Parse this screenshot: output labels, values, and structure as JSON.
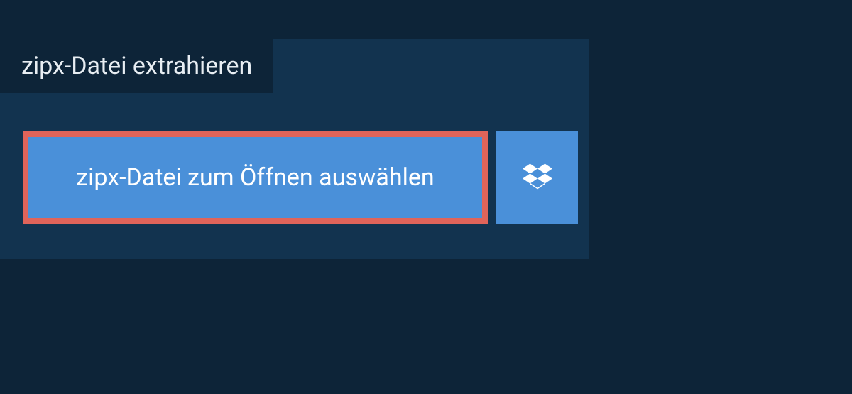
{
  "tab": {
    "label": "zipx-Datei extrahieren"
  },
  "actions": {
    "select_file_label": "zipx-Datei zum Öffnen auswählen"
  },
  "colors": {
    "background": "#0d2438",
    "panel": "#12334f",
    "button": "#4a90d9",
    "highlight_border": "#e0645a",
    "text": "#ffffff"
  }
}
